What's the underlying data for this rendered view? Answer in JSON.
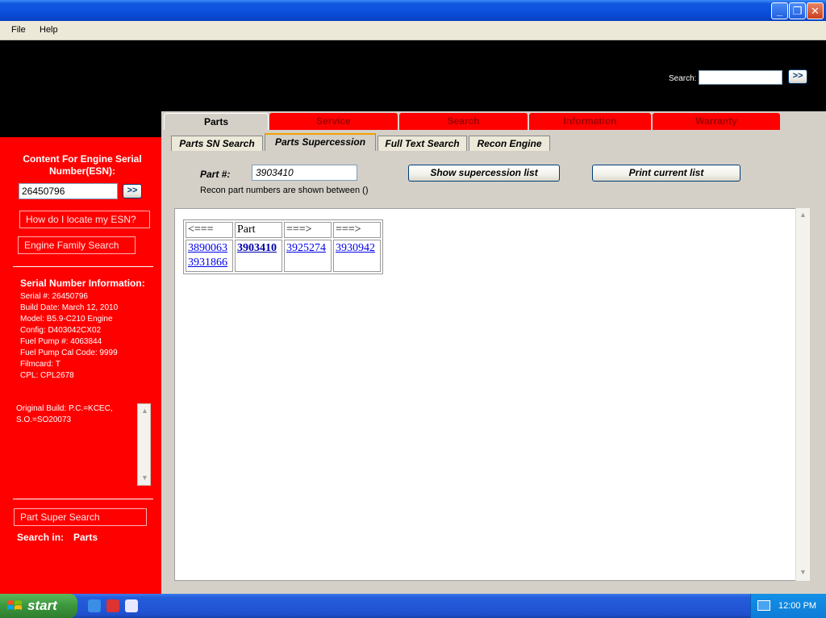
{
  "menu": [
    "File",
    "Help"
  ],
  "header": {
    "search_label": "Search:",
    "search_value": "",
    "go_label": ">>"
  },
  "sidebar": {
    "title": "Content For Engine Serial Number(ESN):",
    "esn_value": "26450796",
    "go_label": ">>",
    "locate_esn": "How do I locate my ESN?",
    "engine_family": "Engine Family Search",
    "sn_info_title": "Serial Number Information:",
    "sn_lines": [
      "Serial #: 26450796",
      "Build Date: March 12, 2010",
      "Model: B5.9-C210   Engine",
      "Config: D403042CX02",
      "Fuel Pump #: 4063844",
      "Fuel Pump Cal Code: 9999",
      "Filmcard: T",
      "CPL: CPL2678"
    ],
    "original_build": [
      "Original Build: P.C.=KCEC,",
      "S.O.=SO20073"
    ],
    "part_super_search": "Part Super Search",
    "search_in_label": "Search in:",
    "search_in_value": "Parts"
  },
  "tabs": [
    "Parts",
    "Service",
    "Search",
    "Information",
    "Warranty"
  ],
  "subtabs": [
    "Parts SN Search",
    "Parts Supercession",
    "Full Text Search",
    "Recon Engine"
  ],
  "form": {
    "part_label": "Part #:",
    "part_value": "3903410",
    "show_button": "Show supercession list",
    "print_button": "Print current list",
    "recon_note": "Recon part numbers are shown between ()"
  },
  "table": {
    "headers": [
      "<===",
      "Part",
      "===>",
      "===>"
    ],
    "col1": [
      "3890063",
      "3931866"
    ],
    "col2": "3903410",
    "col3": "3925274",
    "col4": "3930942"
  },
  "taskbar": {
    "start_label": "start",
    "clock": "12:00 PM"
  },
  "colors": {
    "sidebar": "#ff0000",
    "tab_red": "#ff0000",
    "link": "#0000ee"
  }
}
